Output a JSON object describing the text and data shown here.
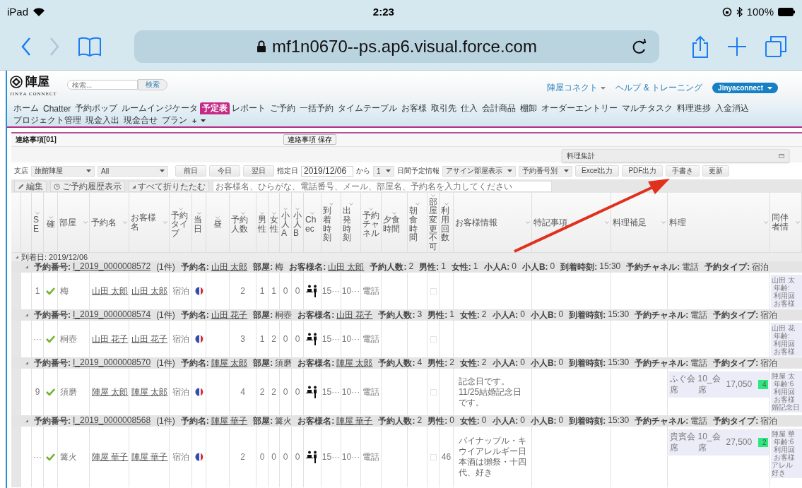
{
  "status_bar": {
    "device": "iPad",
    "time": "2:23",
    "battery": "100%"
  },
  "browser": {
    "url": "mf1n0670--ps.ap6.visual.force.com"
  },
  "header": {
    "logo_text": "陣屋",
    "logo_subtitle": "JINYA CONNECT",
    "search_placeholder": "検索...",
    "search_button": "検索",
    "org_menu": "陣屋コネクト",
    "help_link": "ヘルプ & トレーニング",
    "user_menu": "Jinyaconnect",
    "tabs": [
      {
        "label": "ホーム",
        "selected": false
      },
      {
        "label": "Chatter",
        "selected": false
      },
      {
        "label": "予約ポップ",
        "selected": false
      },
      {
        "label": "ルームインジケータ",
        "selected": false
      },
      {
        "label": "予定表",
        "selected": true
      },
      {
        "label": "レポート",
        "selected": false
      },
      {
        "label": "ご予約",
        "selected": false
      },
      {
        "label": "一括予約",
        "selected": false
      },
      {
        "label": "タイムテーブル",
        "selected": false
      },
      {
        "label": "お客様",
        "selected": false
      },
      {
        "label": "取引先",
        "selected": false
      },
      {
        "label": "仕入",
        "selected": false
      },
      {
        "label": "会計商品",
        "selected": false
      },
      {
        "label": "棚卸",
        "selected": false
      },
      {
        "label": "オーダーエントリー",
        "selected": false
      },
      {
        "label": "マルチタスク",
        "selected": false
      },
      {
        "label": "料理進捗",
        "selected": false
      },
      {
        "label": "入金消込",
        "selected": false
      },
      {
        "label": "プロジェクト管理",
        "selected": false
      },
      {
        "label": "現金入出",
        "selected": false
      },
      {
        "label": "現金合せ",
        "selected": false
      },
      {
        "label": "プラン",
        "selected": false
      }
    ],
    "add_tab": "+"
  },
  "notice": {
    "title": "連絡事項[01]",
    "save_button": "連絡事項 保存"
  },
  "dish_summary": {
    "title": "料理集計"
  },
  "filters": {
    "branch_label": "支店",
    "branch": "旅館陣屋",
    "scope": "All",
    "prev_day": "前日",
    "today": "今日",
    "next_day": "翌日",
    "date_label": "指定日",
    "date": "2019/12/06",
    "from_label": "から",
    "days": "1",
    "days_label": "日間予定情報",
    "room_view": "アサイン部屋表示",
    "sort": "予約番号別",
    "buttons": [
      "Excel出力",
      "PDF出力",
      "手書き",
      "更新"
    ]
  },
  "toolbar": {
    "edit": "編集",
    "history": "ご予約履歴表示",
    "collapse": "すべて折りたたむ",
    "search_placeholder": "お客様名、ひらがな、電話番号、メール、部屋名、予約名を入力してください"
  },
  "table": {
    "columns": [
      "SE",
      "確",
      "部屋",
      "予約名",
      "お客様名",
      "予約タイプ",
      "当日",
      "昼",
      "予約人数",
      "男性",
      "女性",
      "小人A",
      "小人B",
      "Chec",
      "到着時刻",
      "出発時刻",
      "予約チャネル",
      "夕食時間",
      "朝食時間",
      "部屋変更不可",
      "利用回数",
      "お客様情報",
      "特記事項",
      "料理補足",
      "料理",
      "同伴者情"
    ],
    "date_group": "到着日: 2019/12/06",
    "groups": [
      {
        "number_label": "予約番号:",
        "number": "I_2019_0000008572",
        "count": "(1件)",
        "fields": [
          {
            "label": "予約名:",
            "value": "山田 太郎",
            "link": true
          },
          {
            "label": "部屋:",
            "value": "梅",
            "link": false
          },
          {
            "label": "お客様名:",
            "value": "山田 太郎",
            "link": true
          },
          {
            "label": "予約人数:",
            "value": "2",
            "link": false
          },
          {
            "label": "男性:",
            "value": "1",
            "link": false
          },
          {
            "label": "女性:",
            "value": "1",
            "link": false
          },
          {
            "label": "小人A:",
            "value": "0",
            "link": false
          },
          {
            "label": "小人B:",
            "value": "0",
            "link": false
          },
          {
            "label": "到着時刻:",
            "value": "15:30",
            "link": false
          },
          {
            "label": "予約チャネル:",
            "value": "電話",
            "link": false
          },
          {
            "label": "予約タイプ:",
            "value": "宿泊",
            "link": false
          }
        ],
        "row": {
          "seq": "1",
          "confirmed": true,
          "room": "梅",
          "booking_name": "山田 太郎",
          "guest_name": "山田 太郎",
          "booking_type": "宿泊",
          "guests": "2",
          "male": "1",
          "female": "1",
          "child_a": "0",
          "child_b": "0",
          "arrival": "15···",
          "departure": "10···",
          "channel": "電話",
          "room_locked": false,
          "companion": [
            "山田 太",
            "年齢:",
            "利用回",
            "お客様"
          ]
        }
      },
      {
        "number_label": "予約番号:",
        "number": "I_2019_0000008574",
        "count": "(1件)",
        "fields": [
          {
            "label": "予約名:",
            "value": "山田 花子",
            "link": true
          },
          {
            "label": "部屋:",
            "value": "桐壺",
            "link": false
          },
          {
            "label": "お客様名:",
            "value": "山田 花子",
            "link": true
          },
          {
            "label": "予約人数:",
            "value": "3",
            "link": false
          },
          {
            "label": "男性:",
            "value": "1",
            "link": false
          },
          {
            "label": "女性:",
            "value": "2",
            "link": false
          },
          {
            "label": "小人A:",
            "value": "0",
            "link": false
          },
          {
            "label": "小人B:",
            "value": "0",
            "link": false
          },
          {
            "label": "到着時刻:",
            "value": "15:30",
            "link": false
          },
          {
            "label": "予約チャネル:",
            "value": "電話",
            "link": false
          },
          {
            "label": "予約タイプ:",
            "value": "宿泊",
            "link": false
          }
        ],
        "row": {
          "seq": "···",
          "confirmed": true,
          "room": "桐壺",
          "booking_name": "山田 花子",
          "guest_name": "山田 花子",
          "booking_type": "宿泊",
          "guests": "3",
          "male": "1",
          "female": "2",
          "child_a": "0",
          "child_b": "0",
          "arrival": "15···",
          "departure": "10···",
          "channel": "電話",
          "room_locked": false,
          "companion": [
            "山田 花",
            "年齢:",
            "利用回",
            "お客様"
          ]
        }
      },
      {
        "number_label": "予約番号:",
        "number": "I_2019_0000008570",
        "count": "(1件)",
        "fields": [
          {
            "label": "予約名:",
            "value": "陣屋 太郎",
            "link": true
          },
          {
            "label": "部屋:",
            "value": "須磨",
            "link": false
          },
          {
            "label": "お客様名:",
            "value": "陣屋 太郎",
            "link": true
          },
          {
            "label": "予約人数:",
            "value": "4",
            "link": false
          },
          {
            "label": "男性:",
            "value": "2",
            "link": false
          },
          {
            "label": "女性:",
            "value": "2",
            "link": false
          },
          {
            "label": "小人A:",
            "value": "0",
            "link": false
          },
          {
            "label": "小人B:",
            "value": "0",
            "link": false
          },
          {
            "label": "到着時刻:",
            "value": "15:30",
            "link": false
          },
          {
            "label": "予約チャネル:",
            "value": "電話",
            "link": false
          },
          {
            "label": "予約タイプ:",
            "value": "宿泊",
            "link": false
          }
        ],
        "row": {
          "seq": "9",
          "confirmed": true,
          "room": "須磨",
          "booking_name": "陣屋 太郎",
          "guest_name": "陣屋 太郎",
          "booking_type": "宿泊",
          "guests": "4",
          "male": "2",
          "female": "2",
          "child_a": "0",
          "child_b": "0",
          "arrival": "15···",
          "departure": "10···",
          "channel": "電話",
          "room_locked": false,
          "guest_info": "記念日です。11/25結婚記念日です。",
          "dishes": [
            {
              "name": "ふぐ会席",
              "course": "10_会席",
              "price": "17,050",
              "qty": "4"
            }
          ],
          "companion": [
            "陣屋 太",
            "年齢:6",
            "利用回",
            "お客様",
            "婚記念日"
          ]
        }
      },
      {
        "number_label": "予約番号:",
        "number": "I_2019_0000008568",
        "count": "(1件)",
        "fields": [
          {
            "label": "予約名:",
            "value": "陣屋 華子",
            "link": true
          },
          {
            "label": "部屋:",
            "value": "篝火",
            "link": false
          },
          {
            "label": "お客様名:",
            "value": "陣屋 華子",
            "link": true
          },
          {
            "label": "予約人数:",
            "value": "2",
            "link": false
          },
          {
            "label": "男性:",
            "value": "0",
            "link": false
          },
          {
            "label": "女性:",
            "value": "0",
            "link": false
          },
          {
            "label": "小人A:",
            "value": "0",
            "link": false
          },
          {
            "label": "小人B:",
            "value": "0",
            "link": false
          },
          {
            "label": "到着時刻:",
            "value": "15:30",
            "link": false
          },
          {
            "label": "予約チャネル:",
            "value": "電話",
            "link": false
          },
          {
            "label": "予約タイプ:",
            "value": "宿泊",
            "link": false
          }
        ],
        "row": {
          "seq": "···",
          "confirmed": true,
          "room": "篝火",
          "booking_name": "陣屋 華子",
          "guest_name": "陣屋 華子",
          "booking_type": "宿泊",
          "guests": "2",
          "male": "0",
          "female": "0",
          "child_a": "0",
          "child_b": "0",
          "arrival": "15···",
          "departure": "10···",
          "channel": "電話",
          "room_locked": false,
          "visits": "46",
          "guest_info": "パイナップル・キウイアレルギー日本酒は獺祭・十四代、好き",
          "dishes": [
            {
              "name": "貴賓会席",
              "course": "10_会席",
              "price": "27,500",
              "qty": "2"
            }
          ],
          "companion": [
            "陣屋 華",
            "年齢:6",
            "利用回",
            "お客様",
            "アレル",
            "好き"
          ]
        }
      }
    ]
  }
}
